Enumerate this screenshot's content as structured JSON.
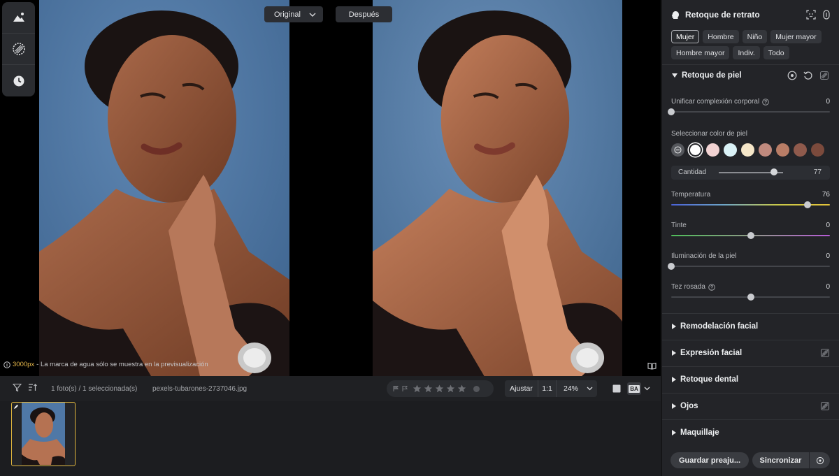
{
  "viewer": {
    "compare": {
      "original_label": "Original",
      "after_label": "Después"
    },
    "note": {
      "resolution": "3000px",
      "text": " - La marca de agua sólo se muestra en la previsualización"
    }
  },
  "filmbar": {
    "count_text": "1 foto(s) / 1 seleccionada(s)",
    "filename": "pexels-tubarones-2737046.jpg",
    "rating_stars": 5,
    "rating_value": 0,
    "zoom_fit": "Ajustar",
    "zoom_one": "1:1",
    "zoom_pct": "24%",
    "ab_label": "BA"
  },
  "panel": {
    "title": "Retoque de retrato",
    "chips": [
      "Mujer",
      "Hombre",
      "Niño",
      "Mujer mayor",
      "Hombre mayor",
      "Indiv.",
      "Todo"
    ],
    "active_chip": "Mujer",
    "skin": {
      "title": "Retoque de piel",
      "unify": {
        "label": "Unificar complexión corporal",
        "value": "0",
        "fraction": 0.0
      },
      "skin_color_label": "Seleccionar color de piel",
      "swatch_colors": [
        "#f2d3d3",
        "#daf2f7",
        "#f5e6c8",
        "#c08a7e",
        "#b97d66",
        "#8f5a4c",
        "#7b4a3c"
      ],
      "amount": {
        "label": "Cantidad",
        "value": "77",
        "fraction": 0.77
      },
      "temperature": {
        "label": "Temperatura",
        "value": "76",
        "fraction": 0.86
      },
      "tint": {
        "label": "Tinte",
        "value": "0",
        "fraction": 0.5
      },
      "lighting": {
        "label": "Iluminación de la piel",
        "value": "0",
        "fraction": 0.0
      },
      "rosy": {
        "label": "Tez rosada",
        "value": "0",
        "fraction": 0.5
      }
    },
    "sections": [
      "Remodelación facial",
      "Expresión facial",
      "Retoque dental",
      "Ojos",
      "Maquillaje"
    ],
    "footer": {
      "save_preset": "Guardar preaju...",
      "sync": "Sincronizar"
    }
  }
}
